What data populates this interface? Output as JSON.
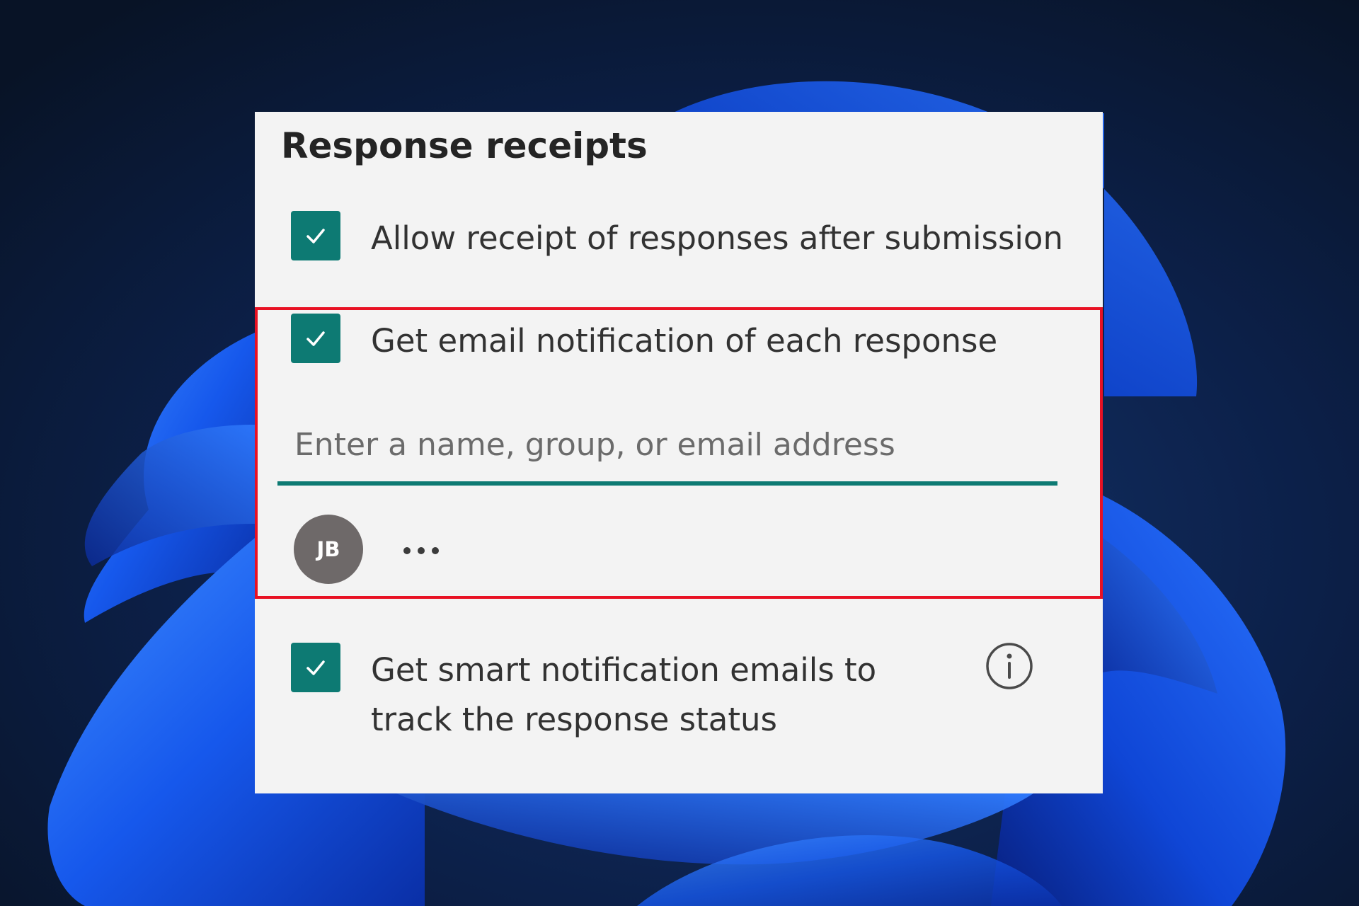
{
  "panel": {
    "title": "Response receipts",
    "options": [
      {
        "label": "Allow receipt of responses after submission",
        "checked": true
      },
      {
        "label": "Get email notification of each response",
        "checked": true
      },
      {
        "label": "Get smart notification emails to track the response status",
        "checked": true
      }
    ],
    "email_field": {
      "placeholder": "Enter a name, group, or email address",
      "value": ""
    },
    "recipients": [
      {
        "initials": "JB"
      }
    ],
    "more_icon": "more-horizontal-icon",
    "info_icon": "info-icon"
  },
  "colors": {
    "accent": "#0d7a73",
    "highlight": "#e81123",
    "panel_background": "#f3f3f3",
    "avatar_background": "#6e6969"
  }
}
